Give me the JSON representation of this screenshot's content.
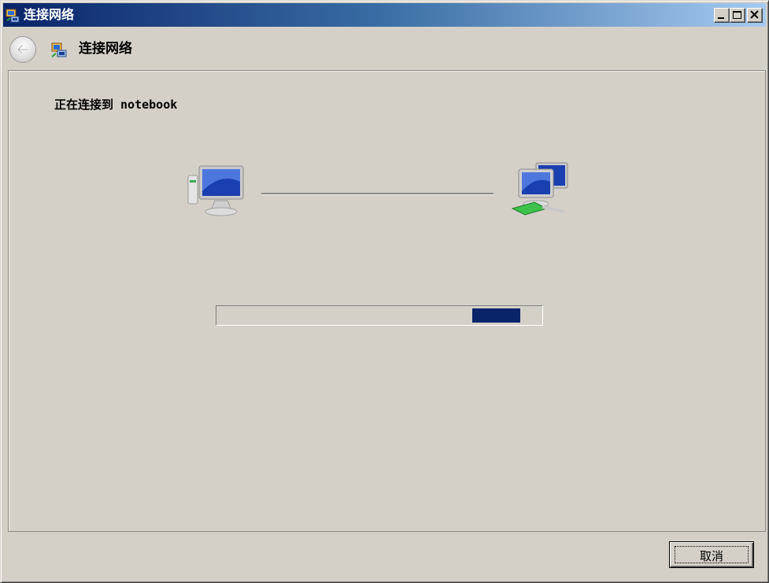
{
  "window": {
    "title": "连接网络",
    "buttons": [
      "minimize",
      "maximize",
      "close"
    ]
  },
  "nav": {
    "title": "连接网络"
  },
  "main": {
    "status_text": "正在连接到 notebook",
    "progress_fraction": 0.15,
    "progress_position": 0.79
  },
  "footer": {
    "cancel_label": "取消"
  },
  "icons": {
    "title": "network-connect-icon",
    "back": "back-arrow-icon",
    "nav": "network-connect-icon",
    "local": "computer-icon",
    "remote": "network-computers-icon"
  },
  "colors": {
    "titlebar_start": "#0a246a",
    "titlebar_end": "#a6caf0",
    "progress_fill": "#0a246a",
    "window_bg": "#d4d0c8"
  }
}
